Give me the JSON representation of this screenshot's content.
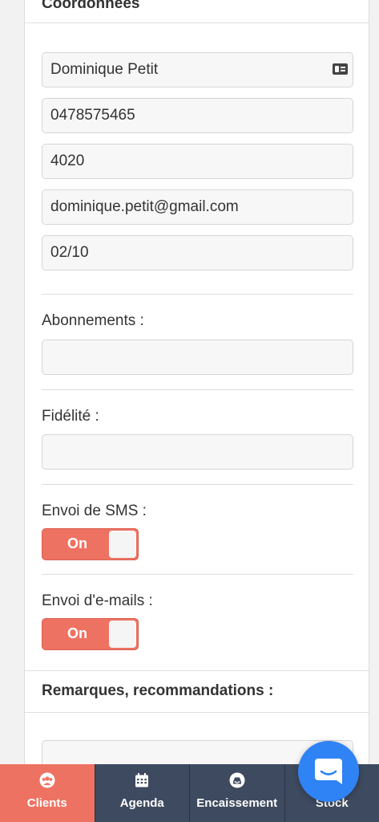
{
  "header": {
    "title": "Coordonnées"
  },
  "contact": {
    "name": "Dominique Petit",
    "phone": "0478575465",
    "postal_code": "4020",
    "email": "dominique.petit@gmail.com",
    "birthday": "02/10",
    "name_icon": "id-card-icon"
  },
  "subscriptions": {
    "label": "Abonnements :",
    "value": ""
  },
  "loyalty": {
    "label": "Fidélité :",
    "value": ""
  },
  "sms": {
    "label": "Envoi de SMS :",
    "toggle_label": "On",
    "state": true
  },
  "emails": {
    "label": "Envoi d'e-mails :",
    "toggle_label": "On",
    "state": true
  },
  "remarks": {
    "title": "Remarques, recommandations :",
    "value": ""
  },
  "colors": {
    "accent": "#ee7262",
    "tabbar": "#3e4a5f",
    "chat": "#2f83f4"
  },
  "tabbar": {
    "tabs": [
      {
        "label": "Clients",
        "icon": "users-icon",
        "active": true
      },
      {
        "label": "Agenda",
        "icon": "calendar-icon",
        "active": false
      },
      {
        "label": "Encaissement",
        "icon": "inbox-icon",
        "active": false
      },
      {
        "label": "Stock",
        "icon": "box-icon",
        "active": false
      }
    ]
  },
  "chat": {
    "icon": "chat-icon"
  }
}
